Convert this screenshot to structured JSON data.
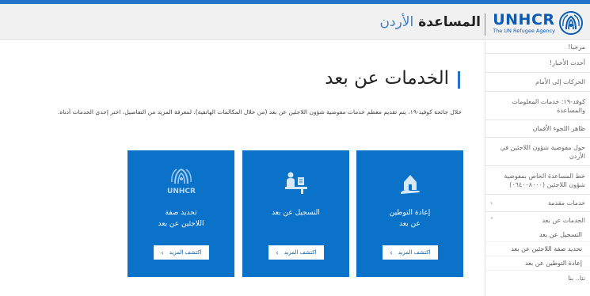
{
  "header": {
    "logo_word": "UNHCR",
    "logo_tagline": "The UN Refugee Agency",
    "site_title_bold": "المساعدة",
    "site_title_light": "الأردن"
  },
  "sidebar": {
    "items": [
      {
        "label": "مرحبا!",
        "caret": ""
      },
      {
        "label": "أحدث الأخبار!",
        "caret": ""
      },
      {
        "label": "الحركات إلى الأمام",
        "caret": ""
      },
      {
        "label": "كوفد-١٩: خدمات المعلومات والمساعدة",
        "caret": ""
      },
      {
        "label": "ظاهر اللجوء الأقمان",
        "caret": ""
      },
      {
        "label": "حول مفوضية شؤون اللاجئين في الأردن",
        "caret": ""
      },
      {
        "label": "خط المساعدة الخاص بمفوضية شؤون اللاجئين (٠٦٤٠٠٨٠٠٠)",
        "caret": ""
      },
      {
        "label": "خدمات مقدمة",
        "caret": "‹"
      },
      {
        "label": "الخدمات عن بعد",
        "caret": "˅"
      }
    ],
    "sub_items": [
      "التسجيل عن بعد",
      "تحديد صفة اللاجئين عن بعد",
      "إعادة التوطين عن بعد"
    ],
    "last_item": "نتا.. بنا"
  },
  "main": {
    "title": "الخدمات عن بعد",
    "intro": "خلال جائحة كوفيد-١٩، يتم تقديم معظم خدمات مفوضية شؤون اللاجئين عن بعد (من خلال المكالمات الهاتفية). لمعرفة المزيد من التفاصيل، اختر إحدى الخدمات أدناه."
  },
  "cards": [
    {
      "icon": "house-hand-icon",
      "title_line1": "إعادة التوطين",
      "title_line2": "عن بعد",
      "button": "اكتشف المزيد"
    },
    {
      "icon": "registration-icon",
      "title_line1": "التسجيل عن بعد",
      "title_line2": "",
      "button": "اكتشف المزيد"
    },
    {
      "icon": "unhcr-emblem-icon",
      "icon_text": "UNHCR",
      "title_line1": "تحديد صفة",
      "title_line2": "اللاجئين عن بعد",
      "button": "اكتشف المزيد"
    }
  ],
  "colors": {
    "accent": "#2373c8",
    "card": "#0a72c8",
    "header_bg": "#f1f1f1"
  }
}
